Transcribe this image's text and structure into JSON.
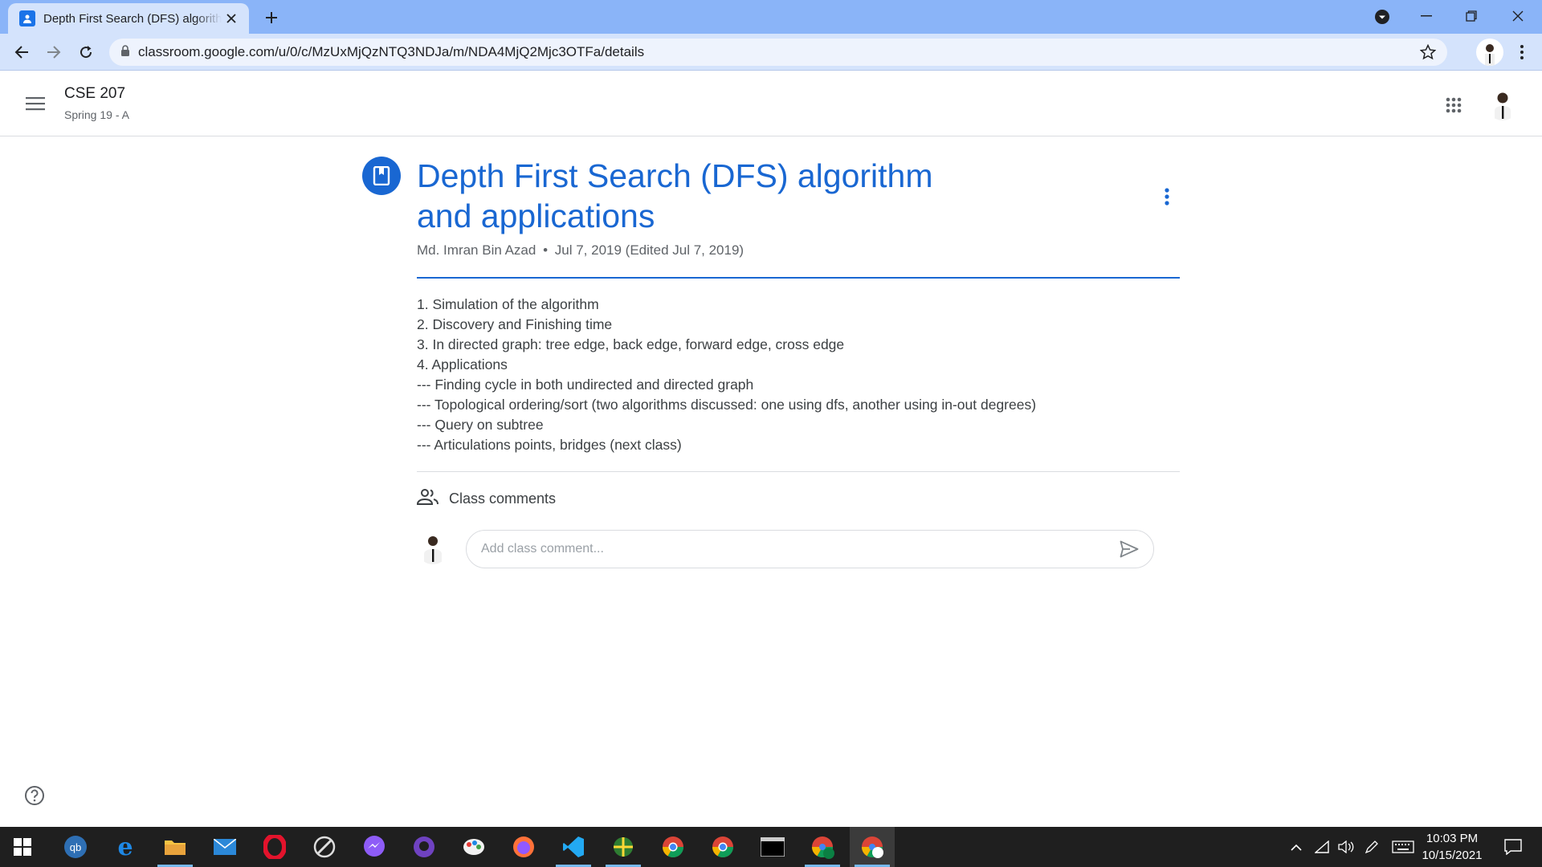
{
  "browser": {
    "tab_title": "Depth First Search (DFS) algorithm and applications",
    "url": "classroom.google.com/u/0/c/MzUxMjQzNTQ3NDJa/m/NDA4MjQ2Mjc3OTFa/details"
  },
  "header": {
    "class_name": "CSE 207",
    "section": "Spring 19 - A"
  },
  "material": {
    "title": "Depth First Search (DFS) algorithm and applications",
    "author": "Md. Imran Bin Azad",
    "separator": "•",
    "date": "Jul 7, 2019 (Edited Jul 7, 2019)",
    "description_lines": [
      "1. Simulation of the algorithm",
      "2. Discovery and Finishing time",
      "3. In directed graph: tree edge, back edge, forward edge, cross edge",
      "4. Applications",
      "--- Finding cycle in both undirected and directed graph",
      "--- Topological ordering/sort (two algorithms discussed: one using dfs, another using in-out degrees)",
      "--- Query on subtree",
      "--- Articulations points, bridges (next class)"
    ]
  },
  "comments": {
    "label": "Class comments",
    "placeholder": "Add class comment..."
  },
  "taskbar": {
    "time": "10:03 PM",
    "date": "10/15/2021",
    "apps": [
      "start-button",
      "quickbooks-icon",
      "edge-icon",
      "file-explorer-icon",
      "mail-icon",
      "opera-icon",
      "inkscape-icon",
      "messenger-icon",
      "github-desktop-icon",
      "paint-icon",
      "firefox-icon",
      "vscode-icon",
      "network-app-icon",
      "chrome-profile-1-icon",
      "chrome-icon",
      "terminal-icon",
      "chrome-profile-ek-icon",
      "chrome-profile-active-icon"
    ]
  },
  "colors": {
    "accent": "#1967d2",
    "tab_bg": "#d4e3fc",
    "tabstrip_bg": "#8ab4f8",
    "taskbar_bg": "#1f1f1f"
  }
}
